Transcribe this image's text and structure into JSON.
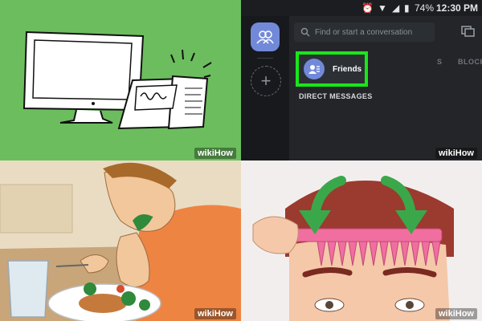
{
  "watermark": "wikiHow",
  "statusbar": {
    "battery": "74%",
    "time": "12:30 PM"
  },
  "discord": {
    "search_placeholder": "Find or start a conversation",
    "tabs": [
      "S",
      "BLOCK"
    ],
    "friends_label": "Friends",
    "direct_messages_heading": "DIRECT MESSAGES",
    "highlight_color": "#19e61a",
    "accent_color": "#7289da"
  }
}
